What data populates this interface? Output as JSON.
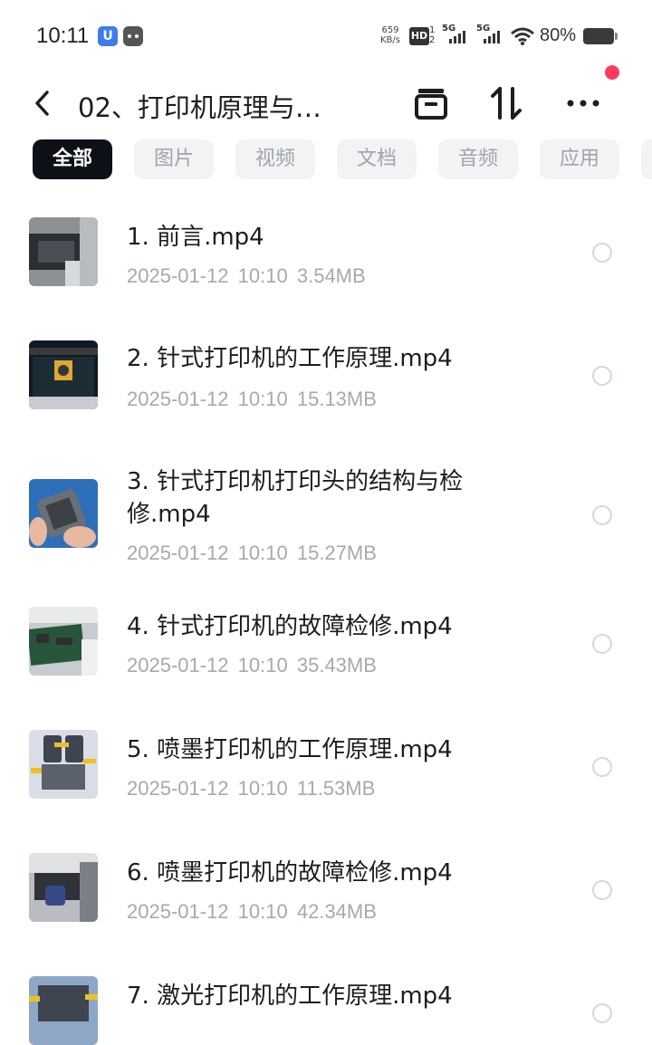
{
  "status_bar": {
    "time": "10:11",
    "net_speed": "659",
    "net_speed_unit": "KB/s",
    "hd_label": "HD",
    "hd_sub": "1\n2",
    "sig1_tag": "5G",
    "sig2_tag": "5G",
    "battery_text": "80%",
    "battery_level": 0.8
  },
  "header": {
    "title": "02、打印机原理与…",
    "icons": [
      "back-icon",
      "archive-icon",
      "sort-icon",
      "more-icon"
    ],
    "notification_dot_color": "#ff3b5c"
  },
  "tabs": [
    {
      "label": "全部",
      "active": true
    },
    {
      "label": "图片",
      "active": false
    },
    {
      "label": "视频",
      "active": false
    },
    {
      "label": "文档",
      "active": false
    },
    {
      "label": "音频",
      "active": false
    },
    {
      "label": "应用",
      "active": false
    }
  ],
  "files": [
    {
      "name": "1. 前言.mp4",
      "date": "2025-01-12",
      "time": "10:10",
      "size": "3.54MB"
    },
    {
      "name": "2. 针式打印机的工作原理.mp4",
      "date": "2025-01-12",
      "time": "10:10",
      "size": "15.13MB"
    },
    {
      "name": "3. 针式打印机打印头的结构与检修.mp4",
      "date": "2025-01-12",
      "time": "10:10",
      "size": "15.27MB"
    },
    {
      "name": "4. 针式打印机的故障检修.mp4",
      "date": "2025-01-12",
      "time": "10:10",
      "size": "35.43MB"
    },
    {
      "name": "5. 喷墨打印机的工作原理.mp4",
      "date": "2025-01-12",
      "time": "10:10",
      "size": "11.53MB"
    },
    {
      "name": "6. 喷墨打印机的故障检修.mp4",
      "date": "2025-01-12",
      "time": "10:10",
      "size": "42.34MB"
    },
    {
      "name": "7. 激光打印机的工作原理.mp4",
      "date": "",
      "time": "",
      "size": ""
    }
  ],
  "colors": {
    "active_tab_bg": "#0d1117",
    "tab_bg": "#f2f3f5",
    "meta_text": "#a5a9b0"
  }
}
